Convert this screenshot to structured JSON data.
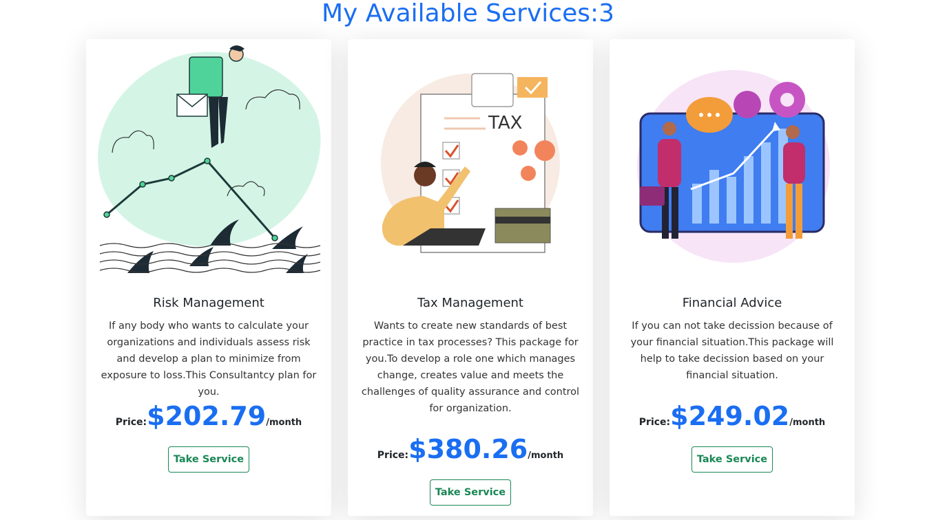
{
  "header": {
    "title": "My Available Services:3"
  },
  "services": [
    {
      "title": "Risk Management",
      "description": "If any body who wants to calculate your organizations and individuals assess risk and develop a plan to minimize from exposure to loss.This Consultantcy plan for you.",
      "price_label": "Price:",
      "price": "$202.79",
      "price_unit": "/month",
      "button_label": "Take Service",
      "illustration": "risk-management-illustration"
    },
    {
      "title": "Tax Management",
      "description": "Wants to create new standards of best practice in tax processes? This package for you.To develop a role one which manages change, creates value and meets the challenges of quality assurance and control for organization.",
      "price_label": "Price:",
      "price": "$380.26",
      "price_unit": "/month",
      "button_label": "Take Service",
      "illustration": "tax-management-illustration",
      "illustration_text": "TAX"
    },
    {
      "title": "Financial Advice",
      "description": "If you can not take decission because of your financial situation.This package will help to take decission based on your financial situation.",
      "price_label": "Price:",
      "price": "$249.02",
      "price_unit": "/month",
      "button_label": "Take Service",
      "illustration": "financial-advice-illustration"
    }
  ],
  "colors": {
    "accent": "#1a6ef2",
    "button": "#198754"
  }
}
